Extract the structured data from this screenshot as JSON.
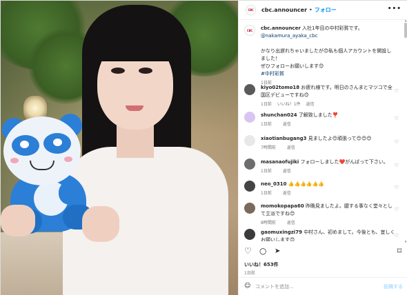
{
  "post": {
    "author": "cbc.announcer",
    "separator": "•",
    "follow_label": "フォロー",
    "more_label": "•••",
    "avatar_text": "CBC",
    "caption_line1": "入社1年目の中村彩賀です。",
    "caption_mention": "@nakamura_ayaka_cbc",
    "caption_line2": "かなり出遅れちゃいましたが😊私も個人アカウントを開設しました！",
    "caption_line3": "ぜひフォローお願いします😊",
    "caption_hashtag": "#中村彩賀",
    "caption_time": "1日前"
  },
  "comments": [
    {
      "user": "kiyo02tomo18",
      "text": "お疲れ様です。明日のさんまとマツコで全国区デビューですね😊",
      "time": "1日前",
      "likes": "いいね！1件",
      "reply": "返信",
      "avatar_color": "#5a5a5a"
    },
    {
      "user": "shunchan024",
      "text": "了解致しました❣️",
      "time": "1日前",
      "likes": "",
      "reply": "返信",
      "avatar_color": "#d9c6f0"
    },
    {
      "user": "xiaotianbugang3",
      "text": "見ましたよ😊頑張って😊😊😊",
      "time": "7時間前",
      "likes": "",
      "reply": "返信",
      "avatar_color": "#e8e8e8"
    },
    {
      "user": "masanaofujiki",
      "text": "フォローしました❤️がんばって下さい。",
      "time": "1日前",
      "likes": "",
      "reply": "返信",
      "avatar_color": "#6d6d6d"
    },
    {
      "user": "neo_0310",
      "text": "👍👍👍👍👍👍",
      "time": "1日前",
      "likes": "",
      "reply": "返信",
      "avatar_color": "#444444"
    },
    {
      "user": "momokopapa60",
      "text": "昨晩見ましたよ。臆する事なく堂々として立派ですね😊",
      "time": "8時間前",
      "likes": "",
      "reply": "返信",
      "avatar_color": "#7a6a5a"
    },
    {
      "user": "gaomuxingzi79",
      "text": "中村さん、初めまして。今後とも、宜しくお願いします😊",
      "time": "",
      "likes": "",
      "reply": "",
      "avatar_color": "#3b3b3b"
    }
  ],
  "footer": {
    "likes": "いいね！653件",
    "date": "1日前",
    "comment_placeholder": "コメントを追加...",
    "post_label": "投稿する",
    "emoji_icon": "☺"
  },
  "icons": {
    "heart": "♡",
    "comment": "○",
    "share": "➤",
    "bookmark": "⌑"
  }
}
